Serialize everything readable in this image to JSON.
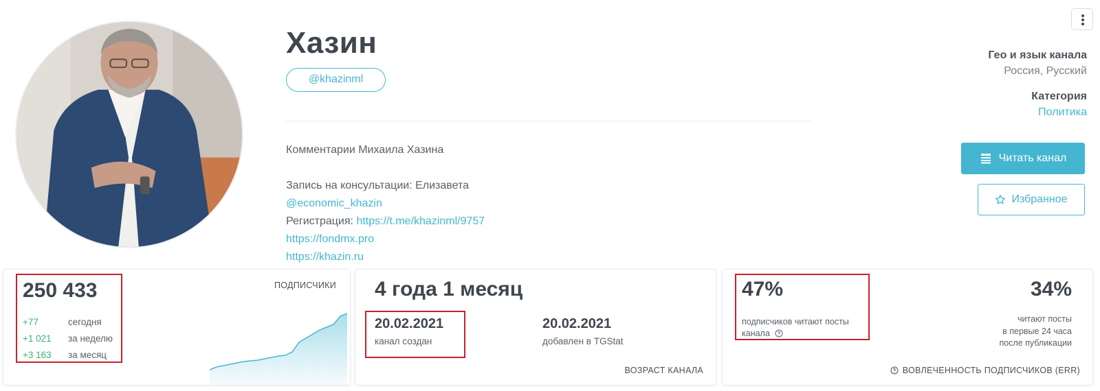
{
  "channel": {
    "title": "Хазин",
    "username": "@khazinml",
    "description": {
      "line1": "Комментарии Михаила Хазина",
      "line2": "Запись на консультации: Елизавета",
      "contact_link": "@economic_khazin",
      "registration_label": "Регистрация:",
      "registration_link": "https://t.me/khazinml/9757",
      "link1": "https://fondmx.pro",
      "link2": "https://khazin.ru"
    }
  },
  "meta": {
    "geo_label": "Гео и язык канала",
    "geo_value": "Россия, Русский",
    "category_label": "Категория",
    "category_value": "Политика"
  },
  "actions": {
    "read_label": "Читать канал",
    "favorite_label": "Избранное"
  },
  "subscribers": {
    "count": "250 433",
    "label": "подписчики",
    "rows": [
      {
        "delta": "+77",
        "period": "сегодня"
      },
      {
        "delta": "+1 021",
        "period": "за неделю"
      },
      {
        "delta": "+3 163",
        "period": "за месяц"
      }
    ]
  },
  "age": {
    "value": "4 года 1 месяц",
    "created_date": "20.02.2021",
    "created_label": "канал создан",
    "added_date": "20.02.2021",
    "added_label": "добавлен в TGStat",
    "footer": "возраст канала"
  },
  "engagement": {
    "read_percent": "47%",
    "read_label_line1": "подписчиков читают посты",
    "read_label_line2": "канала",
    "first24_percent": "34%",
    "first24_line1": "читают посты",
    "first24_line2": "в первые 24 часа",
    "first24_line3": "после публикации",
    "footer": "вовлеченность подписчиков (ERR)"
  },
  "colors": {
    "accent": "#45b6d1",
    "positive": "#3bb273",
    "highlight": "#c8202a",
    "text": "#3f464e"
  },
  "icons": [
    "menu-dots-icon",
    "list-icon",
    "star-icon",
    "help-circle-icon",
    "help-circle-icon"
  ]
}
